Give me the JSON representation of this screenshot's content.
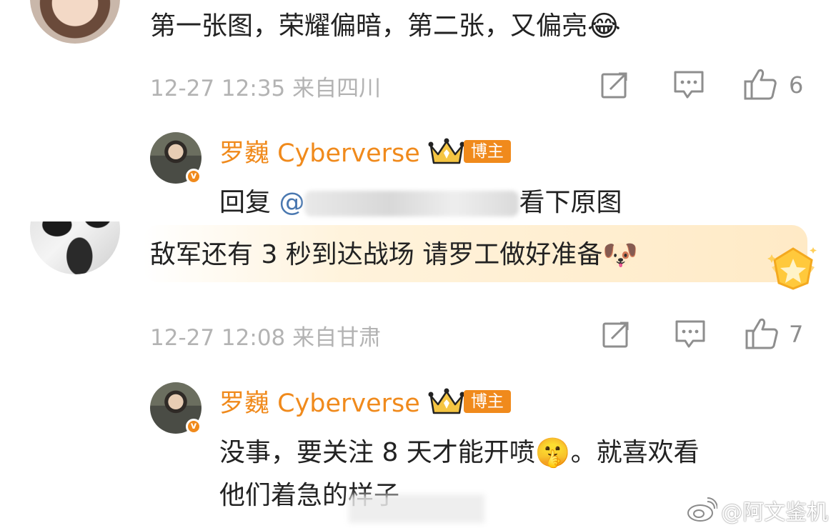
{
  "comments": [
    {
      "text": "第一张图，荣耀偏暗，第二张，又偏亮",
      "emoji": "😂",
      "meta": "12-27 12:35 来自四川",
      "likes": "6",
      "reply": {
        "name": "罗巍 Cyberverse",
        "badge": "博主",
        "prefix": "回复",
        "mention": "@",
        "suffix": "看下原图"
      }
    },
    {
      "text": "敌军还有 3 秒到达战场 请罗工做好准备",
      "emoji": "🐶",
      "meta": "12-27 12:08 来自甘肃",
      "likes": "7",
      "reply": {
        "name": "罗巍 Cyberverse",
        "badge": "博主",
        "line1_a": "没事，要关注 8 天才能开喷",
        "emoji": "🤫",
        "line1_b": "。就喜欢看",
        "line2": "他们着急的样子"
      }
    }
  ],
  "watermark": "@阿文鉴机",
  "colors": {
    "accent": "#f08a1c",
    "meta": "#b3b3b3",
    "link": "#4a78b0"
  }
}
